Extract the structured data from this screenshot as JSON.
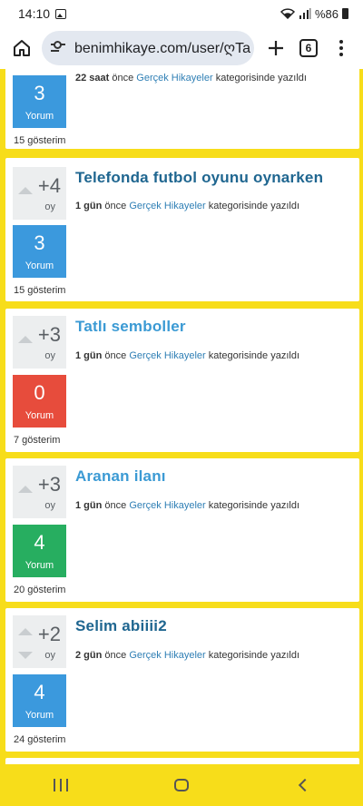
{
  "status_bar": {
    "time": "14:10",
    "battery": "%86"
  },
  "browser": {
    "url": "benimhikaye.com/user/ღTa",
    "tab_count": "6"
  },
  "colors": {
    "accent_yellow": "#f7dd1a",
    "comment_blue": "#3b99dd",
    "comment_red": "#e74c3c",
    "comment_green": "#27ae60",
    "title_dark": "#1f6690",
    "title_light": "#3b9ad4"
  },
  "posts": [
    {
      "title": "",
      "votes": "",
      "votes_label": "",
      "comments": "3",
      "comments_label": "Yorum",
      "time_bold": "22 saat",
      "meta_mid": " önce ",
      "category": "Gerçek Hikayeler",
      "meta_end": " kategorisinde yazıldı",
      "views": "15 gösterim"
    },
    {
      "title": "Telefonda futbol oyunu oynarken",
      "votes": "+4",
      "votes_label": "oy",
      "comments": "3",
      "comments_label": "Yorum",
      "time_bold": "1 gün",
      "meta_mid": " önce ",
      "category": "Gerçek Hikayeler",
      "meta_end": " kategorisinde yazıldı",
      "views": "15 gösterim"
    },
    {
      "title": "Tatlı semboller",
      "votes": "+3",
      "votes_label": "oy",
      "comments": "0",
      "comments_label": "Yorum",
      "time_bold": "1 gün",
      "meta_mid": " önce ",
      "category": "Gerçek Hikayeler",
      "meta_end": " kategorisinde yazıldı",
      "views": "7 gösterim"
    },
    {
      "title": "Aranan ilanı",
      "votes": "+3",
      "votes_label": "oy",
      "comments": "4",
      "comments_label": "Yorum",
      "time_bold": "1 gün",
      "meta_mid": " önce ",
      "category": "Gerçek Hikayeler",
      "meta_end": " kategorisinde yazıldı",
      "views": "20 gösterim"
    },
    {
      "title": "Selim abiiii2",
      "votes": "+2",
      "votes_label": "oy",
      "comments": "4",
      "comments_label": "Yorum",
      "time_bold": "2 gün",
      "meta_mid": " önce ",
      "category": "Gerçek Hikayeler",
      "meta_end": " kategorisinde yazıldı",
      "views": "24 gösterim"
    }
  ]
}
